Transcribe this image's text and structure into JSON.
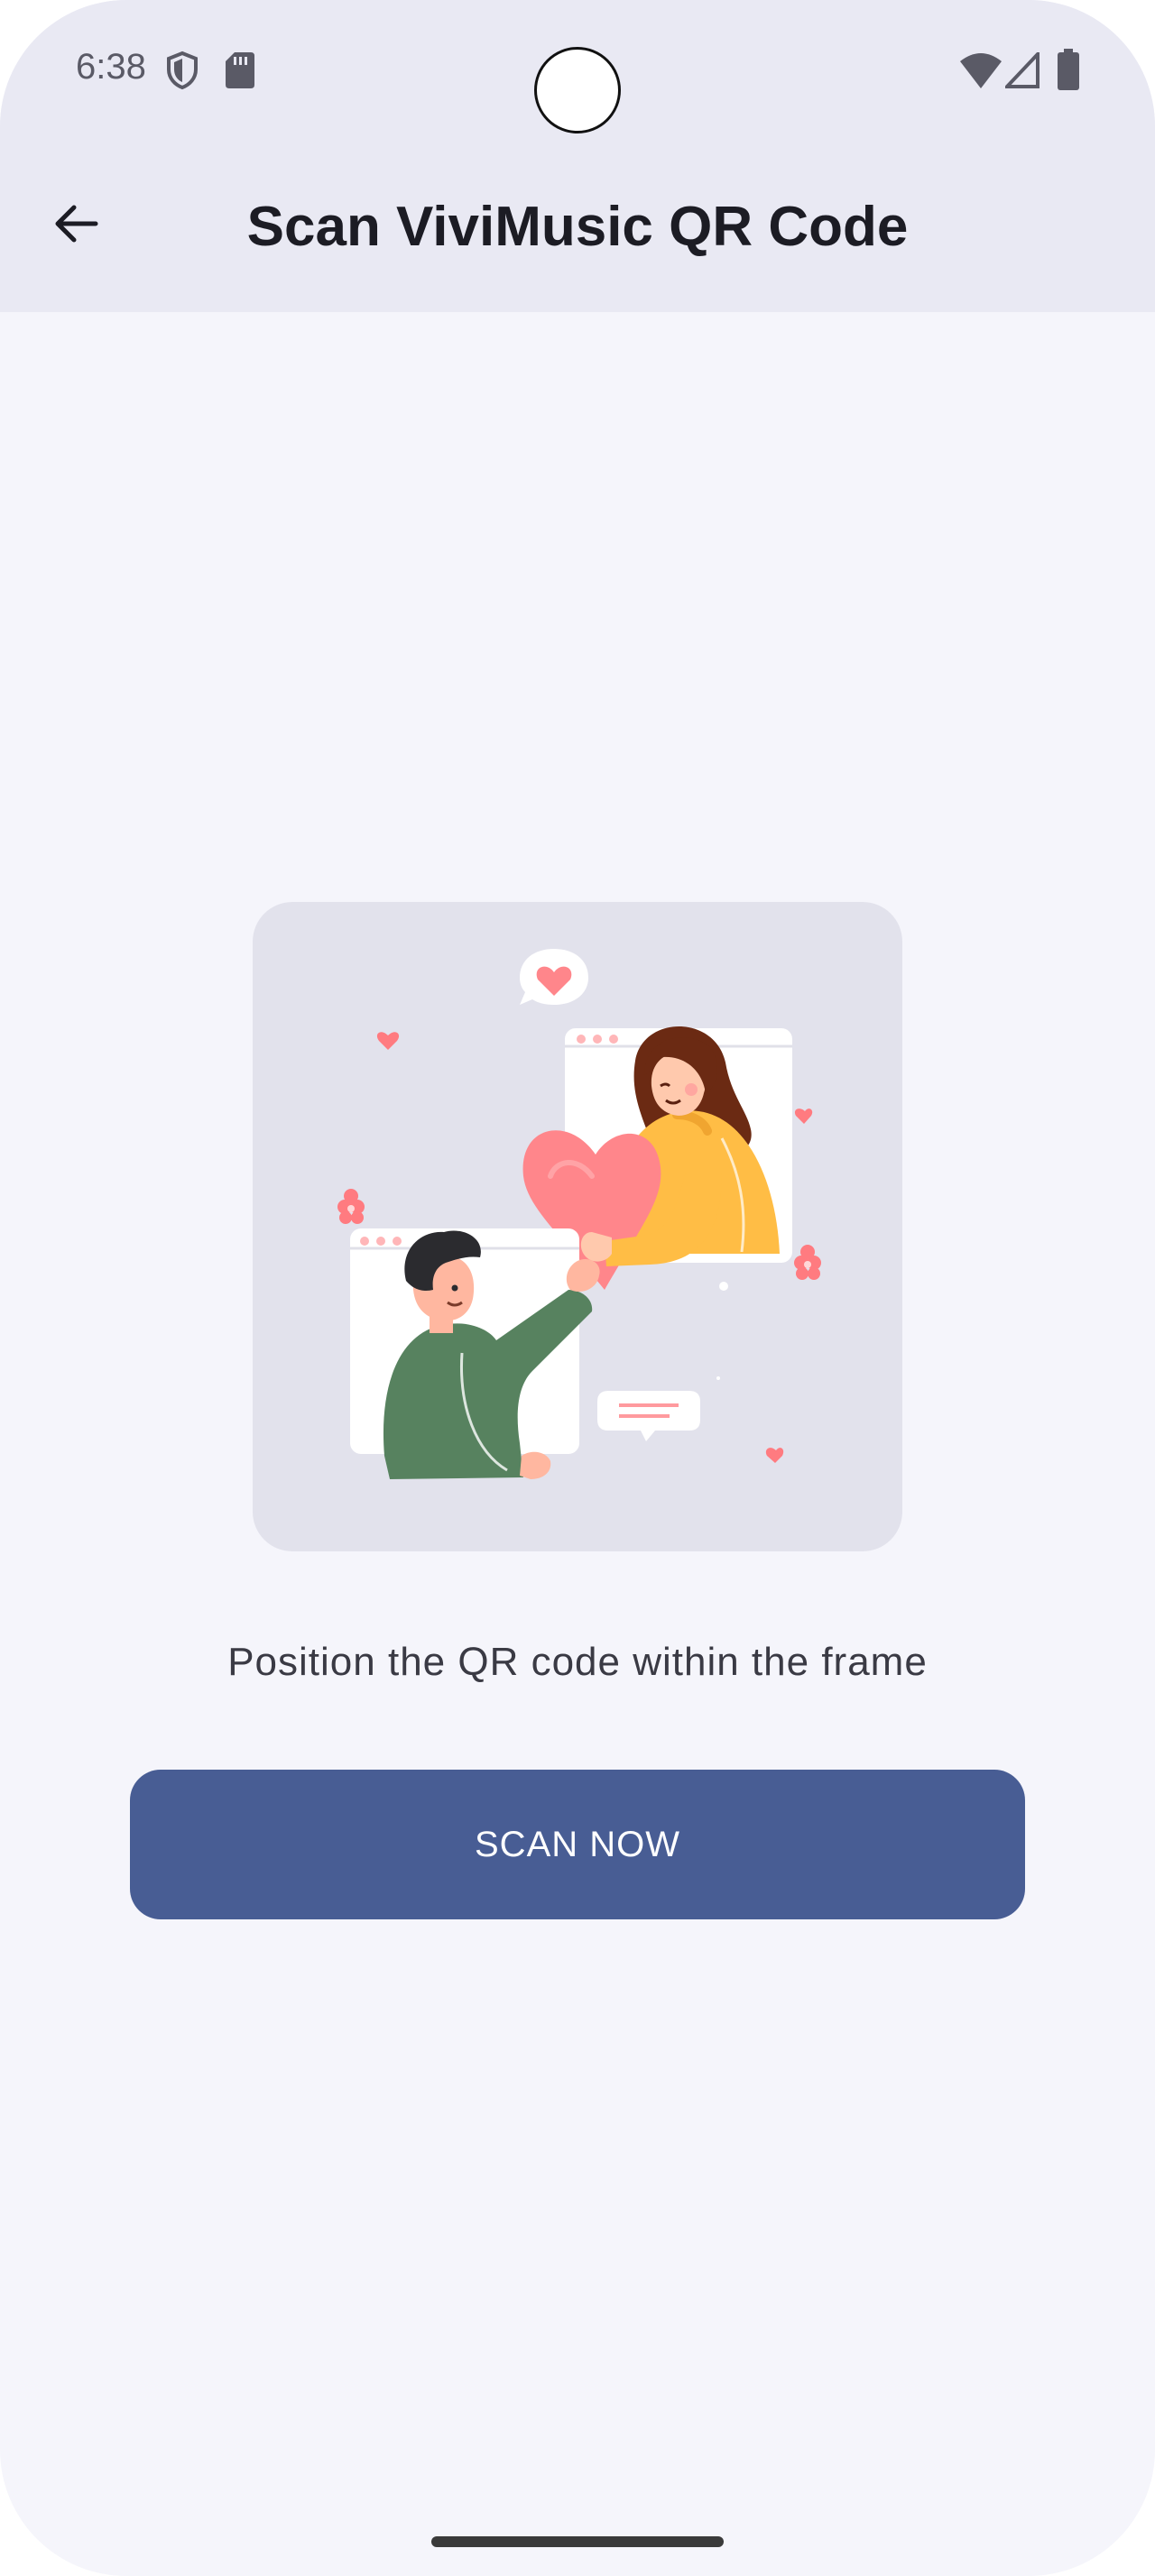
{
  "status_bar": {
    "time": "6:38",
    "icons": [
      "shield-icon",
      "sd-card-icon",
      "wifi-icon",
      "signal-icon",
      "battery-icon"
    ]
  },
  "header": {
    "back_icon": "arrow-left-icon",
    "title": "Scan ViviMusic QR Code"
  },
  "main": {
    "illustration": "two-people-sharing-heart-illustration",
    "instruction": "Position the QR code within the frame",
    "scan_button_label": "SCAN NOW"
  },
  "colors": {
    "top_bar": "#e9e9f3",
    "background": "#f5f5fb",
    "primary_button": "#485d94",
    "heart": "#ff868b",
    "sweater_yellow": "#ffbd45",
    "sweater_green": "#57825f"
  }
}
